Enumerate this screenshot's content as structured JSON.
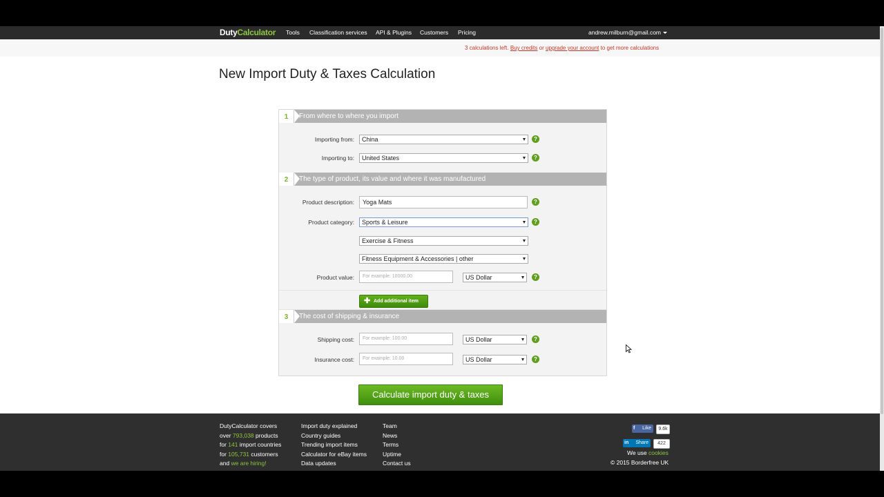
{
  "navbar": {
    "logo_part1": "Duty",
    "logo_part2": "Calculator",
    "items": [
      "Tools",
      "Classification services",
      "API & Plugins",
      "Customers",
      "Pricing"
    ],
    "user_email": "andrew.milburn@gmail.com"
  },
  "notice": {
    "prefix": "3 calculations left.",
    "buy_link": "Buy credits",
    "middle": "or",
    "upgrade_link": "upgrade your account",
    "suffix": "to get more calculations"
  },
  "page_title": "New Import Duty & Taxes Calculation",
  "sections": [
    {
      "number": "1",
      "title": "From where to where you import"
    },
    {
      "number": "2",
      "title": "The type of product, its value and where it was manufactured"
    },
    {
      "number": "3",
      "title": "The cost of shipping & insurance"
    }
  ],
  "form": {
    "importing_from": {
      "label": "Importing from:",
      "value": "China"
    },
    "importing_to": {
      "label": "Importing to:",
      "value": "United States"
    },
    "product_description": {
      "label": "Product description:",
      "value": "Yoga Mats"
    },
    "product_category": {
      "label": "Product category:",
      "value": "Sports & Leisure"
    },
    "subcategory": {
      "value": "Exercise & Fitness"
    },
    "subsubcategory": {
      "value": "Fitness Equipment & Accessories | other"
    },
    "product_value": {
      "label": "Product value:",
      "placeholder": "For example: 10000.00",
      "currency": "US Dollar"
    },
    "add_item_label": "Add additional item",
    "shipping_cost": {
      "label": "Shipping cost:",
      "placeholder": "For example: 100.00",
      "currency": "US Dollar"
    },
    "insurance_cost": {
      "label": "Insurance cost:",
      "placeholder": "For example: 10.00",
      "currency": "US Dollar"
    },
    "help_glyph": "?"
  },
  "calculate_button": "Calculate import duty & taxes",
  "footer": {
    "about": {
      "l1": "DutyCalculator covers",
      "l2_pre": "over",
      "products_count": "793,038",
      "l2_post": "products",
      "l3_pre": "for",
      "countries_count": "141",
      "l3_post": "import countries",
      "l4_pre": "for",
      "customers_count": "105,731",
      "l4_post": "customers",
      "l5_pre": "and",
      "hiring_link": "we are hiring!"
    },
    "links_col1": [
      "Import duty explained",
      "Country guides",
      "Trending import items",
      "Calculator for eBay items",
      "Data updates"
    ],
    "links_col2": [
      "Team",
      "News",
      "Terms",
      "Uptime",
      "Contact us"
    ],
    "fb_like": "Like",
    "fb_count": "9.6k",
    "li_share": "Share",
    "li_count": "422",
    "cookies_pre": "We use",
    "cookies_link": "cookies",
    "copyright": "© 2015 Borderfree UK"
  }
}
